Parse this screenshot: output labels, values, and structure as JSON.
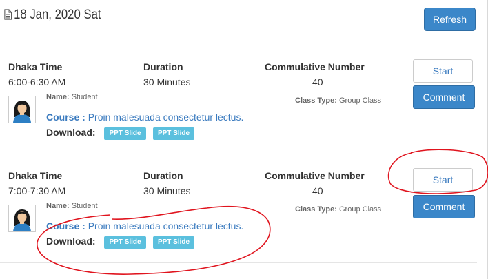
{
  "header": {
    "date": "18 Jan, 2020 Sat",
    "refresh_label": "Refresh"
  },
  "labels": {
    "time": "Dhaka Time",
    "duration": "Duration",
    "number": "Commulative Number",
    "name": "Name:",
    "class_type": "Class Type:",
    "course": "Course :",
    "download": "Download:",
    "start": "Start",
    "comment": "Comment"
  },
  "sessions": [
    {
      "time": "6:00-6:30 AM",
      "duration": "30 Minutes",
      "number": "40",
      "name": "Student",
      "class_type": "Group Class",
      "course": "Proin malesuada consectetur lectus.",
      "downloads": [
        "PPT Slide",
        "PPT Slide"
      ]
    },
    {
      "time": "7:00-7:30 AM",
      "duration": "30 Minutes",
      "number": "40",
      "name": "Student",
      "class_type": "Group Class",
      "course": "Proin malesuada consectetur lectus.",
      "downloads": [
        "PPT Slide",
        "PPT Slide"
      ]
    }
  ],
  "colors": {
    "primary": "#3b87c9",
    "link": "#3b7bbf",
    "badge": "#5bc0de",
    "annotation": "#e0141e"
  }
}
